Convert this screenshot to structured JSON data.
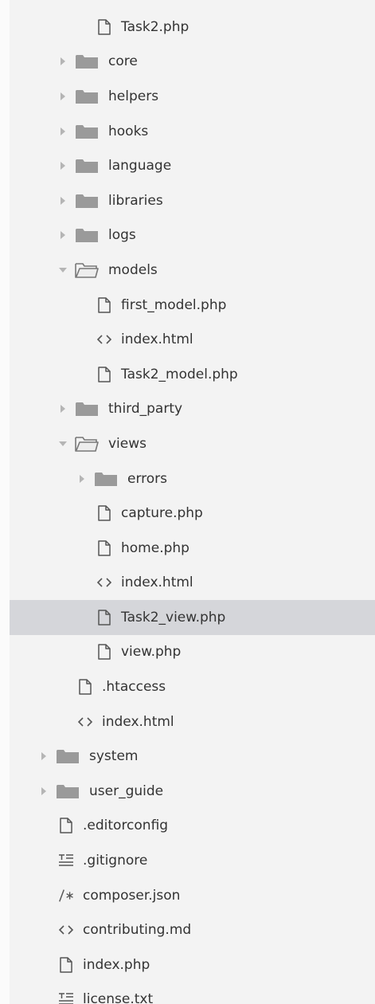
{
  "tree": {
    "rows": [
      {
        "label": "Task2.php",
        "kind": "file",
        "icon": "file-icon",
        "depth": 4
      },
      {
        "label": "core",
        "kind": "folder",
        "icon": "folder-icon",
        "state": "collapsed",
        "depth": 3
      },
      {
        "label": "helpers",
        "kind": "folder",
        "icon": "folder-icon",
        "state": "collapsed",
        "depth": 3
      },
      {
        "label": "hooks",
        "kind": "folder",
        "icon": "folder-icon",
        "state": "collapsed",
        "depth": 3
      },
      {
        "label": "language",
        "kind": "folder",
        "icon": "folder-icon",
        "state": "collapsed",
        "depth": 3
      },
      {
        "label": "libraries",
        "kind": "folder",
        "icon": "folder-icon",
        "state": "collapsed",
        "depth": 3
      },
      {
        "label": "logs",
        "kind": "folder",
        "icon": "folder-icon",
        "state": "collapsed",
        "depth": 3
      },
      {
        "label": "models",
        "kind": "folder",
        "icon": "folder-open-icon",
        "state": "expanded",
        "depth": 3
      },
      {
        "label": "first_model.php",
        "kind": "file",
        "icon": "file-icon",
        "depth": 4
      },
      {
        "label": "index.html",
        "kind": "file",
        "icon": "code-icon",
        "depth": 4
      },
      {
        "label": "Task2_model.php",
        "kind": "file",
        "icon": "file-icon",
        "depth": 4
      },
      {
        "label": "third_party",
        "kind": "folder",
        "icon": "folder-icon",
        "state": "collapsed",
        "depth": 3
      },
      {
        "label": "views",
        "kind": "folder",
        "icon": "folder-open-icon",
        "state": "expanded",
        "depth": 3
      },
      {
        "label": "errors",
        "kind": "folder",
        "icon": "folder-icon",
        "state": "collapsed",
        "depth": 4
      },
      {
        "label": "capture.php",
        "kind": "file",
        "icon": "file-icon",
        "depth": 4
      },
      {
        "label": "home.php",
        "kind": "file",
        "icon": "file-icon",
        "depth": 4
      },
      {
        "label": "index.html",
        "kind": "file",
        "icon": "code-icon",
        "depth": 4
      },
      {
        "label": "Task2_view.php",
        "kind": "file",
        "icon": "file-icon",
        "depth": 4,
        "selected": true
      },
      {
        "label": "view.php",
        "kind": "file",
        "icon": "file-icon",
        "depth": 4
      },
      {
        "label": ".htaccess",
        "kind": "file",
        "icon": "file-icon",
        "depth": 3
      },
      {
        "label": "index.html",
        "kind": "file",
        "icon": "code-icon",
        "depth": 3
      },
      {
        "label": "system",
        "kind": "folder",
        "icon": "folder-icon",
        "state": "collapsed",
        "depth": 2
      },
      {
        "label": "user_guide",
        "kind": "folder",
        "icon": "folder-icon",
        "state": "collapsed",
        "depth": 2
      },
      {
        "label": ".editorconfig",
        "kind": "file",
        "icon": "file-icon",
        "depth": 2
      },
      {
        "label": ".gitignore",
        "kind": "file",
        "icon": "text-lines-icon",
        "depth": 2
      },
      {
        "label": "composer.json",
        "kind": "file",
        "icon": "json-icon",
        "depth": 2
      },
      {
        "label": "contributing.md",
        "kind": "file",
        "icon": "code-icon",
        "depth": 2
      },
      {
        "label": "index.php",
        "kind": "file",
        "icon": "file-icon",
        "depth": 2
      },
      {
        "label": "license.txt",
        "kind": "file",
        "icon": "text-lines-icon",
        "depth": 2
      }
    ]
  },
  "colors": {
    "background": "#f3f3f3",
    "selected_row": "#d5d6da",
    "folder_fill": "#9a9a9a",
    "icon_stroke": "#555555",
    "text": "#333333"
  }
}
